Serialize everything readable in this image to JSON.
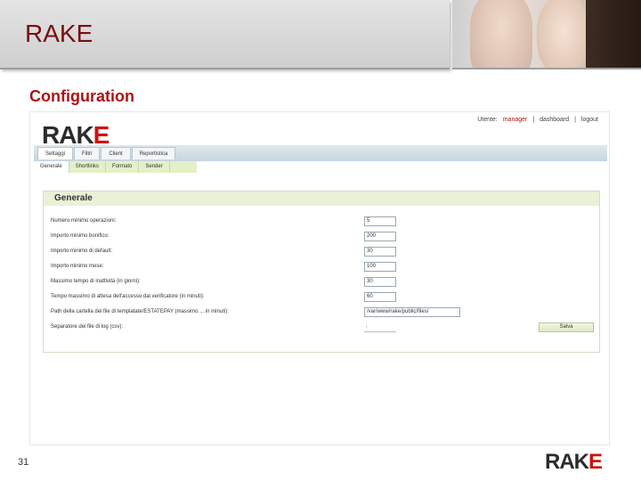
{
  "slide": {
    "title": "RAKE",
    "section": "Configuration",
    "page_number": "31"
  },
  "branding": {
    "logo_main": "RAK",
    "logo_accent": "E",
    "accent_color": "#d01010"
  },
  "app": {
    "user_bar": {
      "user_label": "Utente:",
      "user_name": "manager",
      "separator": "|",
      "dashboard": "dashboard",
      "logout": "logout"
    },
    "nav_tabs": [
      "Settaggi",
      "Filtri",
      "Client",
      "Reportistica"
    ],
    "sub_tabs": [
      "Generale",
      "Shortlinks",
      "Formato",
      "Sender"
    ],
    "panel": {
      "title": "Generale",
      "fields": [
        {
          "label": "Numero minimo operazioni:",
          "value": "5"
        },
        {
          "label": "Importo minimo bonifico:",
          "value": "200"
        },
        {
          "label": "Importo minimo di default:",
          "value": "30"
        },
        {
          "label": "Importo minimo mese:",
          "value": "100"
        },
        {
          "label": "Massimo tempo di inattività (in giorni):",
          "value": "30"
        },
        {
          "label": "Tempo massimo di attesa dell'accesso dal verificatore (in minuti):",
          "value": "60"
        },
        {
          "label": "Path della cartella dei file di templatate/ESTATEPAY (massimo ... in minuti):",
          "value": "/var/www/rake/public/files/"
        },
        {
          "label": "Separatore dei file di log (csv):",
          "value": ";"
        }
      ],
      "save_label": "Salva"
    }
  }
}
